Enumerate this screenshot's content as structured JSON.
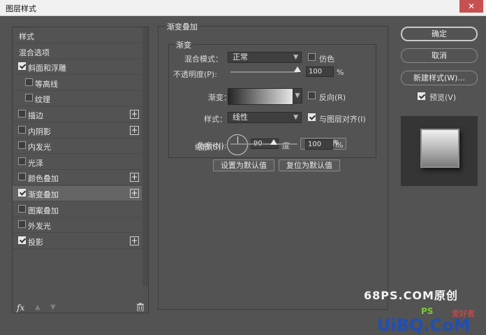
{
  "window": {
    "title": "图层样式",
    "close_glyph": "✕"
  },
  "styles_list": {
    "items": [
      {
        "label": "样式",
        "has_checkbox": false,
        "checked": false,
        "indent": false,
        "has_plus": false,
        "selected": false
      },
      {
        "label": "混合选项",
        "has_checkbox": false,
        "checked": false,
        "indent": false,
        "has_plus": false,
        "selected": false
      },
      {
        "label": "斜面和浮雕",
        "has_checkbox": true,
        "checked": true,
        "indent": false,
        "has_plus": false,
        "selected": false
      },
      {
        "label": "等高线",
        "has_checkbox": true,
        "checked": false,
        "indent": true,
        "has_plus": false,
        "selected": false
      },
      {
        "label": "纹理",
        "has_checkbox": true,
        "checked": false,
        "indent": true,
        "has_plus": false,
        "selected": false
      },
      {
        "label": "描边",
        "has_checkbox": true,
        "checked": false,
        "indent": false,
        "has_plus": true,
        "selected": false
      },
      {
        "label": "内阴影",
        "has_checkbox": true,
        "checked": false,
        "indent": false,
        "has_plus": true,
        "selected": false
      },
      {
        "label": "内发光",
        "has_checkbox": true,
        "checked": false,
        "indent": false,
        "has_plus": false,
        "selected": false
      },
      {
        "label": "光泽",
        "has_checkbox": true,
        "checked": false,
        "indent": false,
        "has_plus": false,
        "selected": false
      },
      {
        "label": "颜色叠加",
        "has_checkbox": true,
        "checked": false,
        "indent": false,
        "has_plus": true,
        "selected": false
      },
      {
        "label": "渐变叠加",
        "has_checkbox": true,
        "checked": true,
        "indent": false,
        "has_plus": true,
        "selected": true
      },
      {
        "label": "图案叠加",
        "has_checkbox": true,
        "checked": false,
        "indent": false,
        "has_plus": false,
        "selected": false
      },
      {
        "label": "外发光",
        "has_checkbox": true,
        "checked": false,
        "indent": false,
        "has_plus": false,
        "selected": false
      },
      {
        "label": "投影",
        "has_checkbox": true,
        "checked": true,
        "indent": false,
        "has_plus": true,
        "selected": false
      }
    ],
    "footer": {
      "fx_label": "fx",
      "up_glyph": "▲",
      "down_glyph": "▼",
      "plus_glyph": "+"
    }
  },
  "gradient_overlay": {
    "section_title": "渐变叠加",
    "subsection_title": "渐变",
    "blend_mode": {
      "label": "混合模式：",
      "value": "正常"
    },
    "dither": {
      "label": "仿色",
      "checked": false
    },
    "opacity": {
      "label": "不透明度(P):",
      "value": "100",
      "unit": "%",
      "percent": 100
    },
    "gradient": {
      "label": "渐变："
    },
    "reverse": {
      "label": "反向(R)",
      "checked": false
    },
    "style": {
      "label": "样式：",
      "value": "线性"
    },
    "align_with_layer": {
      "label": "与图层对齐(I)",
      "checked": true
    },
    "angle": {
      "label": "角度(N):",
      "value": "90",
      "unit": "度",
      "degrees": 90
    },
    "reset_alignment_label": "重置对齐",
    "scale": {
      "label": "缩放(S):",
      "value": "100",
      "unit": "%",
      "percent": 100
    },
    "set_default_label": "设置为默认值",
    "reset_default_label": "复位为默认值"
  },
  "actions": {
    "ok_label": "确定",
    "cancel_label": "取消",
    "new_style_label": "新建样式(W)...",
    "preview": {
      "label": "预览(V)",
      "checked": true
    }
  },
  "watermark": {
    "line1": "68PS.COM原创",
    "line2_a": "PS",
    "line2_b": "爱好者",
    "line3": "UiBQ.CoM"
  },
  "colors": {
    "panel_bg": "#535353",
    "input_bg": "#3f3f3f",
    "selected_row": "#656565",
    "close_button": "#c75050",
    "watermark_green": "#7ec63e",
    "watermark_red": "#e14a4a"
  }
}
